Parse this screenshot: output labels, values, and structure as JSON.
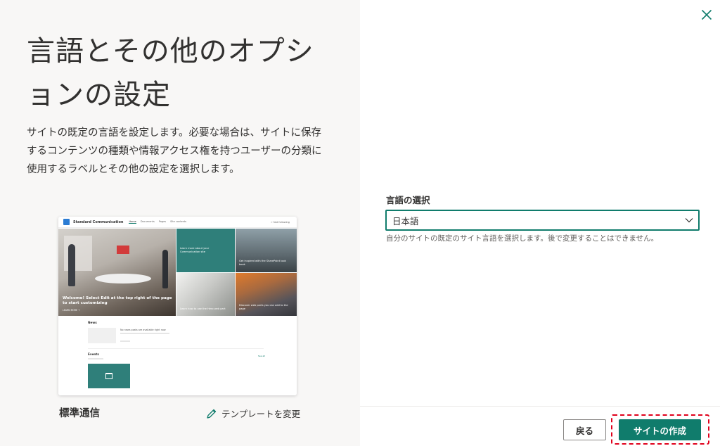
{
  "panel": {
    "title": "言語とその他のオプションの設定",
    "description": "サイトの既定の言語を設定します。必要な場合は、サイトに保存するコンテンツの種類や情報アクセス権を持つユーザーの分類に使用するラベルとその他の設定を選択します。"
  },
  "preview": {
    "site_name": "Standard Communication",
    "nav": [
      "Home",
      "Documents",
      "Pages",
      "Site contents"
    ],
    "follow": "☆ Not following",
    "hero_text": "Welcome! Select Edit at the top right of the page to start customizing",
    "hero_more": "LEARN MORE →",
    "tiles": [
      "Learn more about your Communication site",
      "Get inspired with the SharePoint look book",
      "Learn how to use the Hero web part",
      "Discover web parts you can add to the page"
    ],
    "news_title": "News",
    "news_line": "No news posts are available right now",
    "events_title": "Events",
    "events_see_all": "See all"
  },
  "template": {
    "name": "標準通信",
    "change_label": "テンプレートを変更",
    "change_icon": "pencil-icon"
  },
  "language": {
    "label": "言語の選択",
    "selected": "日本語",
    "help": "自分のサイトの既定のサイト言語を選択します。後で変更することはできません。"
  },
  "footer": {
    "back_label": "戻る",
    "create_label": "サイトの作成"
  },
  "colors": {
    "accent": "#107c6c",
    "highlight": "#e0001b",
    "left_panel_bg": "#f8f7f6"
  }
}
